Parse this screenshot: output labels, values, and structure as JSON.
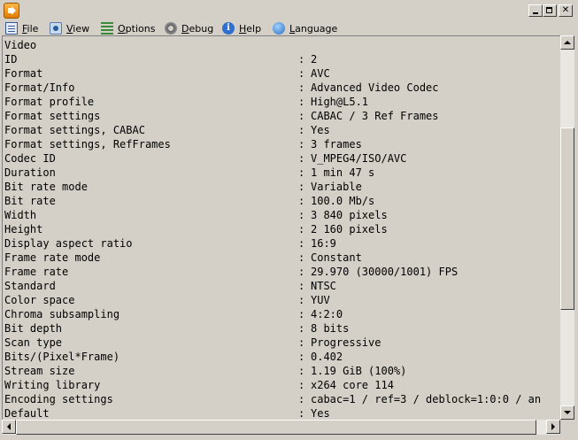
{
  "window": {
    "title": ""
  },
  "menu": [
    {
      "label": "File",
      "icon": "file-icon"
    },
    {
      "label": "View",
      "icon": "view-icon"
    },
    {
      "label": "Options",
      "icon": "options-icon"
    },
    {
      "label": "Debug",
      "icon": "debug-icon"
    },
    {
      "label": "Help",
      "icon": "help-icon"
    },
    {
      "label": "Language",
      "icon": "language-icon"
    }
  ],
  "section_header": "Video",
  "rows": [
    {
      "field": "ID",
      "value": "2"
    },
    {
      "field": "Format",
      "value": "AVC"
    },
    {
      "field": "Format/Info",
      "value": "Advanced Video Codec"
    },
    {
      "field": "Format profile",
      "value": "High@L5.1"
    },
    {
      "field": "Format settings",
      "value": "CABAC / 3 Ref Frames"
    },
    {
      "field": "Format settings, CABAC",
      "value": "Yes"
    },
    {
      "field": "Format settings, RefFrames",
      "value": "3 frames"
    },
    {
      "field": "Codec ID",
      "value": "V_MPEG4/ISO/AVC"
    },
    {
      "field": "Duration",
      "value": "1 min 47 s"
    },
    {
      "field": "Bit rate mode",
      "value": "Variable"
    },
    {
      "field": "Bit rate",
      "value": "100.0 Mb/s"
    },
    {
      "field": "Width",
      "value": "3 840 pixels"
    },
    {
      "field": "Height",
      "value": "2 160 pixels"
    },
    {
      "field": "Display aspect ratio",
      "value": "16:9"
    },
    {
      "field": "Frame rate mode",
      "value": "Constant"
    },
    {
      "field": "Frame rate",
      "value": "29.970 (30000/1001) FPS"
    },
    {
      "field": "Standard",
      "value": "NTSC"
    },
    {
      "field": "Color space",
      "value": "YUV"
    },
    {
      "field": "Chroma subsampling",
      "value": "4:2:0"
    },
    {
      "field": "Bit depth",
      "value": "8 bits"
    },
    {
      "field": "Scan type",
      "value": "Progressive"
    },
    {
      "field": "Bits/(Pixel*Frame)",
      "value": "0.402"
    },
    {
      "field": "Stream size",
      "value": "1.19 GiB (100%)"
    },
    {
      "field": "Writing library",
      "value": "x264 core 114"
    },
    {
      "field": "Encoding settings",
      "value": "cabac=1 / ref=3 / deblock=1:0:0 / an"
    },
    {
      "field": "Default",
      "value": "Yes"
    }
  ],
  "separator": ":"
}
